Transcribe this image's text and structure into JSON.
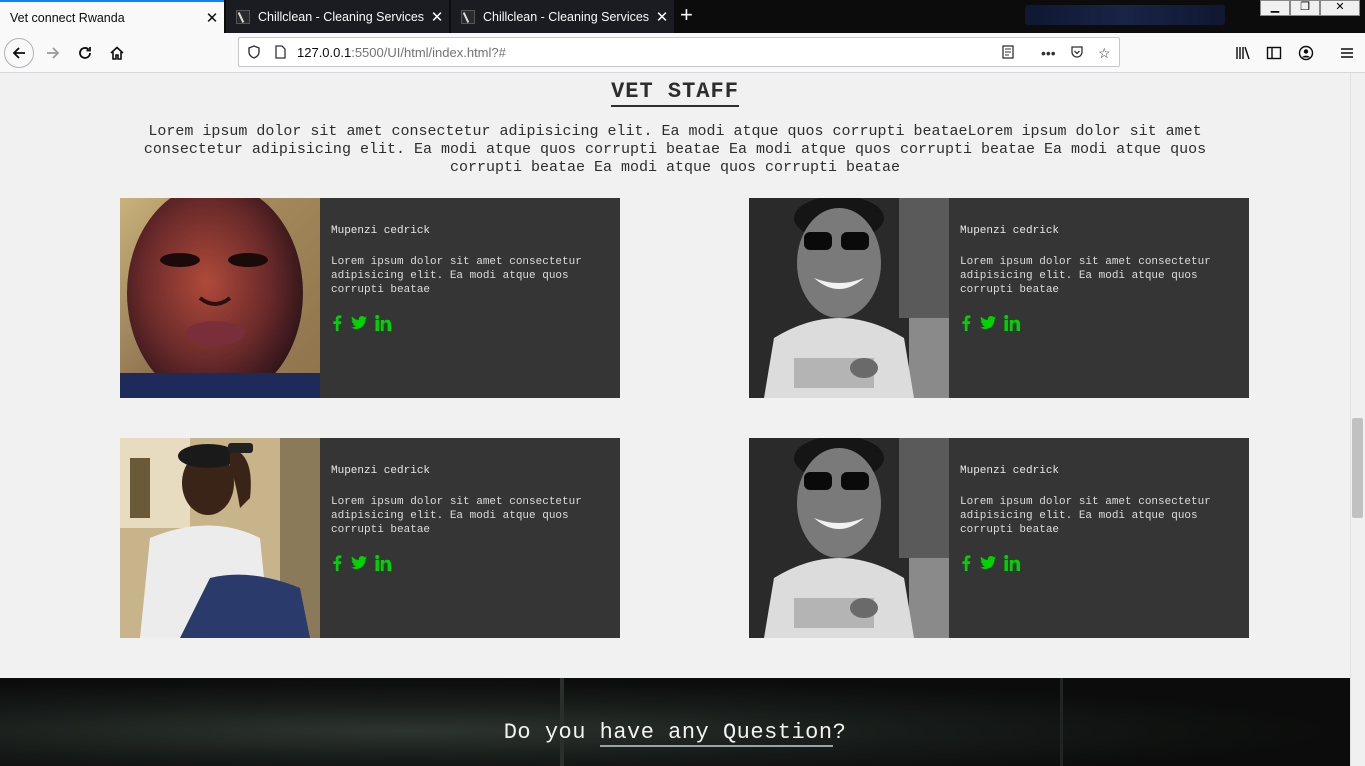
{
  "browser": {
    "tabs": [
      {
        "title": "Vet connect Rwanda",
        "active": true
      },
      {
        "title": "Chillclean - Cleaning Services H",
        "active": false
      },
      {
        "title": "Chillclean - Cleaning Services H",
        "active": false
      }
    ],
    "new_tab": "+",
    "url_host": "127.0.0.1",
    "url_rest": ":5500/UI/html/index.html?#",
    "window_controls": [
      "minimize",
      "restore",
      "close"
    ]
  },
  "staff_section": {
    "title": "VET STAFF",
    "intro": "Lorem ipsum dolor sit amet consectetur adipisicing elit. Ea modi atque quos corrupti beataeLorem ipsum dolor sit amet consectetur adipisicing elit. Ea modi atque quos corrupti beatae Ea modi atque quos corrupti beatae Ea modi atque quos corrupti beatae Ea modi atque quos corrupti beatae",
    "cards": [
      {
        "name": "Mupenzi cedrick",
        "description": "Lorem ipsum dolor sit amet consectetur adipisicing elit. Ea modi atque quos corrupti beatae",
        "photo": "portrait-color-closeup",
        "socials": [
          "facebook-icon",
          "twitter-icon",
          "linkedin-icon"
        ]
      },
      {
        "name": "Mupenzi cedrick",
        "description": "Lorem ipsum dolor sit amet consectetur adipisicing elit. Ea modi atque quos corrupti beatae",
        "photo": "portrait-bw-sunglasses",
        "socials": [
          "facebook-icon",
          "twitter-icon",
          "linkedin-icon"
        ]
      },
      {
        "name": "Mupenzi cedrick",
        "description": "Lorem ipsum dolor sit amet consectetur adipisicing elit. Ea modi atque quos corrupti beatae",
        "photo": "portrait-white-shirt",
        "socials": [
          "facebook-icon",
          "twitter-icon",
          "linkedin-icon"
        ]
      },
      {
        "name": "Mupenzi cedrick",
        "description": "Lorem ipsum dolor sit amet consectetur adipisicing elit. Ea modi atque quos corrupti beatae",
        "photo": "portrait-bw-sunglasses",
        "socials": [
          "facebook-icon",
          "twitter-icon",
          "linkedin-icon"
        ]
      }
    ]
  },
  "question_section": {
    "text_before": "Do you ",
    "text_underlined": "have any Question",
    "text_after": "?"
  },
  "colors": {
    "card_bg": "#353535",
    "social_green": "#00d400",
    "page_bg": "#f1f1f1",
    "tab_accent": "#0a84ff"
  }
}
